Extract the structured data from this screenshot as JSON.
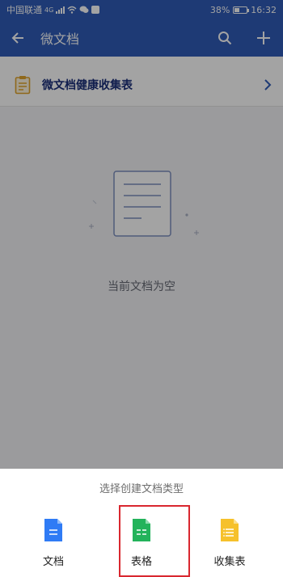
{
  "status_bar": {
    "carrier": "中国联通",
    "network": "4G",
    "battery_percent": "38%",
    "time": "16:32"
  },
  "app_bar": {
    "title": "微文档",
    "back_icon": "arrow-left-icon",
    "search_icon": "search-icon",
    "add_icon": "plus-icon"
  },
  "banner": {
    "label": "微文档健康收集表",
    "icon": "clipboard-icon"
  },
  "empty_state": {
    "text": "当前文档为空"
  },
  "sheet": {
    "title": "选择创建文档类型",
    "options": [
      {
        "label": "文档",
        "color": "#2f7bf5"
      },
      {
        "label": "表格",
        "color": "#23b35b"
      },
      {
        "label": "收集表",
        "color": "#f6c12b"
      }
    ]
  },
  "colors": {
    "primary": "#2f5bb7",
    "highlight": "#d9272f"
  }
}
